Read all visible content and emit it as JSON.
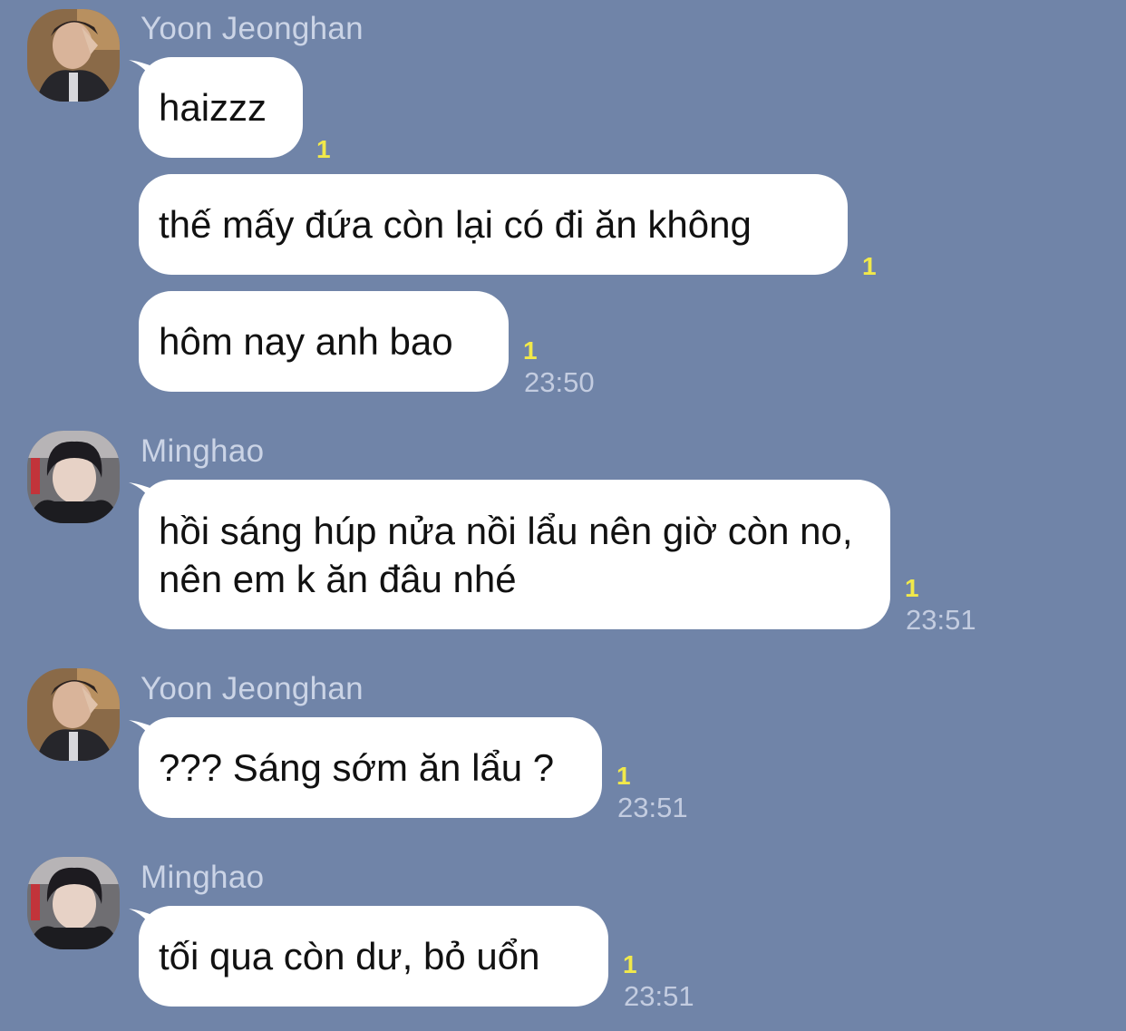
{
  "messages": [
    {
      "sender": "Yoon Jeonghan",
      "bubbles": [
        {
          "text": "haizzz",
          "read": "1",
          "time": ""
        },
        {
          "text": "thế mấy đứa còn lại có đi ăn không",
          "read": "1",
          "time": ""
        },
        {
          "text": "hôm nay anh bao",
          "read": "1",
          "time": "23:50"
        }
      ]
    },
    {
      "sender": "Minghao",
      "bubbles": [
        {
          "text": "hồi sáng húp nửa nồi lẩu nên giờ còn no, nên em k ăn đâu nhé",
          "read": "1",
          "time": "23:51"
        }
      ]
    },
    {
      "sender": "Yoon Jeonghan",
      "bubbles": [
        {
          "text": "??? Sáng sớm ăn lẩu ?",
          "read": "1",
          "time": "23:51"
        }
      ]
    },
    {
      "sender": "Minghao",
      "bubbles": [
        {
          "text": "tối qua còn dư, bỏ uổn",
          "read": "1",
          "time": "23:51"
        }
      ]
    }
  ]
}
